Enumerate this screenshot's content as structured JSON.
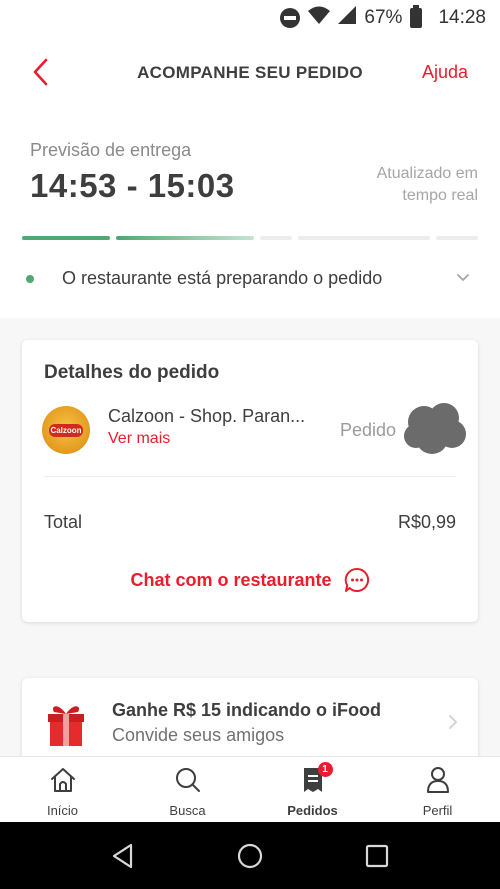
{
  "status_bar": {
    "battery": "67%",
    "time": "14:28"
  },
  "header": {
    "title": "ACOMPANHE SEU PEDIDO",
    "help": "Ajuda"
  },
  "forecast": {
    "label": "Previsão de entrega",
    "time_range": "14:53 - 15:03",
    "realtime": "Atualizado em tempo real"
  },
  "progress": {
    "segments": [
      {
        "fill": 1
      },
      {
        "fill": 1
      },
      {
        "fill": 0
      },
      {
        "fill": 0
      },
      {
        "fill": 0
      }
    ]
  },
  "status": {
    "text": "O restaurante está preparando o pedido"
  },
  "order": {
    "title": "Detalhes do pedido",
    "restaurant": "Calzoon - Shop. Paran...",
    "logo_text": "Calzoon",
    "see_more": "Ver mais",
    "order_label": "Pedido",
    "total_label": "Total",
    "total_value": "R$0,99",
    "chat": "Chat com o restaurante"
  },
  "promo": {
    "title": "Ganhe R$ 15 indicando o iFood",
    "subtitle": "Convide seus amigos"
  },
  "tabs": [
    {
      "label": "Início",
      "icon": "home-icon"
    },
    {
      "label": "Busca",
      "icon": "search-icon"
    },
    {
      "label": "Pedidos",
      "icon": "orders-icon",
      "badge": "1",
      "active": true
    },
    {
      "label": "Perfil",
      "icon": "profile-icon"
    }
  ],
  "colors": {
    "brand": "#ea1d2c",
    "progress": "#50a773",
    "text": "#3f3e3e"
  }
}
